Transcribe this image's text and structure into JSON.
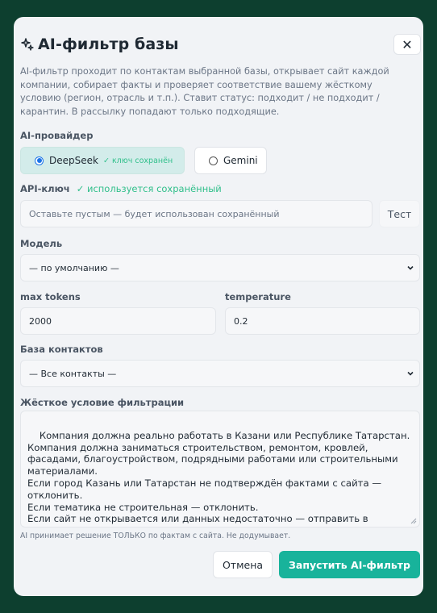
{
  "dialog": {
    "title": "AI-фильтр базы",
    "title_icon": "sparkle-icon",
    "close_label": "✕",
    "description": "AI-фильтр проходит по контактам выбранной базы, открывает сайт каждой компании, собирает факты и проверяет соответствие вашему жёсткому условию (регион, отрасль и т.п.). Ставит статус: подходит / не подходит / карантин. В рассылку попадают только подходящие."
  },
  "provider": {
    "label": "AI-провайдер",
    "options": [
      {
        "label": "DeepSeek",
        "note": "✓ ключ сохранён",
        "selected": true
      },
      {
        "label": "Gemini",
        "note": "",
        "selected": false
      }
    ]
  },
  "api_key": {
    "label": "API-ключ",
    "status": "✓ используется сохранённый",
    "placeholder": "Оставьте пустым — будет использован сохранённый",
    "test_label": "Тест"
  },
  "model": {
    "label": "Модель",
    "value": "— по умолчанию —"
  },
  "max_tokens": {
    "label": "max tokens",
    "value": "2000"
  },
  "temperature": {
    "label": "temperature",
    "value": "0.2"
  },
  "contacts_base": {
    "label": "База контактов",
    "value": "— Все контакты —"
  },
  "condition": {
    "label": "Жёсткое условие фильтрации",
    "text": "Компания должна реально работать в Казани или Республике Татарстан.\nКомпания должна заниматься строительством, ремонтом, кровлей, фасадами, благоустройством, подрядными работами или строительными материалами.\nЕсли город Казань или Татарстан не подтверждён фактами с сайта — отклонить.\nЕсли тематика не строительная — отклонить.\nЕсли сайт не открывается или данных недостаточно — отправить в карантин.\nНельзя фантазировать. Решение принимать только по фактам.",
    "hint": "AI принимает решение ТОЛЬКО по фактам с сайта. Не додумывает."
  },
  "actions": {
    "cancel_label": "Отмена",
    "run_label": "Запустить AI-фильтр"
  },
  "colors": {
    "backdrop": "#0d3f2f",
    "accent": "#18b39b",
    "success_text": "#2fbf8a",
    "selected_card": "#d3ecea"
  }
}
